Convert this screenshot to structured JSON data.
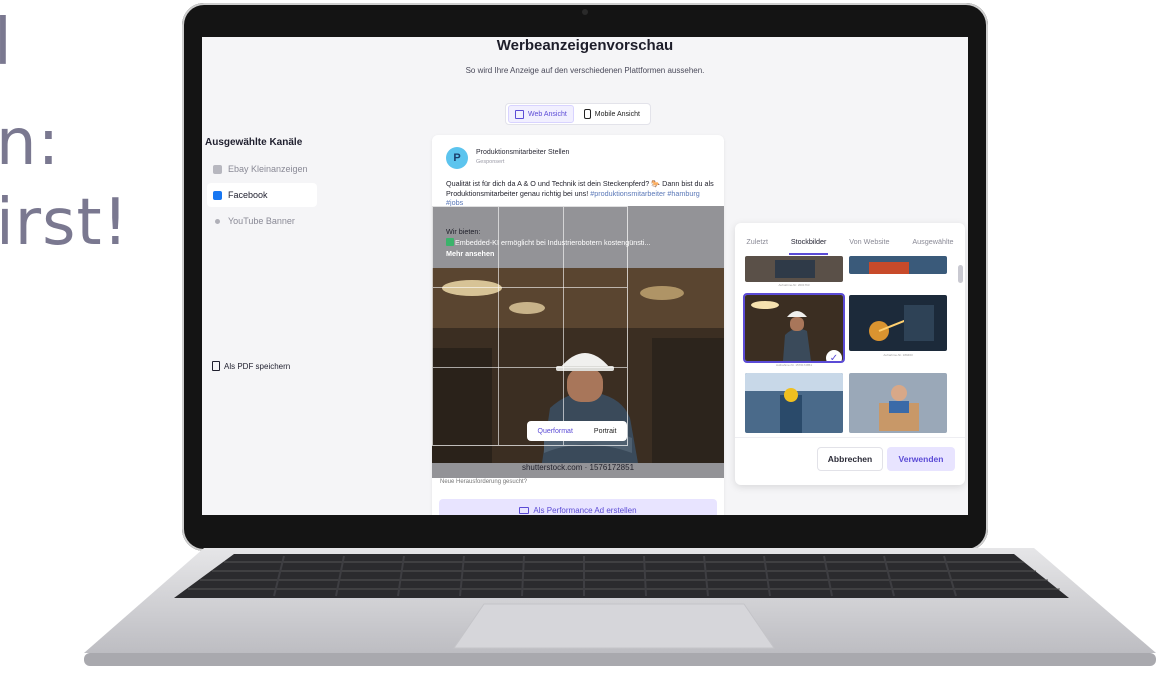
{
  "background_text": {
    "line1": "l",
    "line2": "n:",
    "line3": "irst!"
  },
  "page": {
    "title": "Werbeanzeigenvorschau",
    "subtitle": "So wird Ihre Anzeige auf den verschiedenen Plattformen aussehen."
  },
  "view_toggle": {
    "web_label": "Web Ansicht",
    "mobile_label": "Mobile Ansicht",
    "active": "web"
  },
  "sidebar": {
    "heading": "Ausgewählte Kanäle",
    "items": [
      {
        "label": "Ebay Kleinanzeigen",
        "icon": "ebay-icon",
        "active": false
      },
      {
        "label": "Facebook",
        "icon": "facebook-icon",
        "active": true
      },
      {
        "label": "YouTube Banner",
        "icon": "youtube-icon",
        "active": false
      }
    ],
    "pdf_label": "Als PDF speichern"
  },
  "ad": {
    "avatar_letter": "P",
    "page_name": "Produktionsmitarbeiter Stellen",
    "sponsored": "Gesponsert",
    "text_part1": "Qualität ist für dich da A & O und Technik ist dein Steckenpferd? 🐎 Dann bist du als Produktionsmitarbeiter genau richtig bei uns! ",
    "hashtags": "#produktionsmitarbeiter #hamburg #jobs",
    "offer_heading": "Wir bieten:",
    "offer_line": "Embedded-KI ermöglicht bei Industrierobotern kostengünsti...",
    "more_label": "Mehr ansehen",
    "image_credit": "shutterstock.com · 1576172851",
    "under_text": "Neue Herausforderung gesucht?",
    "performance_button": "Als Performance Ad erstellen"
  },
  "format_toggle": {
    "landscape": "Querformat",
    "portrait": "Portrait",
    "active": "landscape"
  },
  "stock_panel": {
    "tabs": [
      "Zuletzt",
      "Stockbilder",
      "Von Website",
      "Ausgewählte"
    ],
    "active_tab": "Stockbilder",
    "thumb_captions": [
      "Aufnahme-Nr. 2001763",
      "Aufnahme-Nr. 1576172851",
      "Aufnahme-Nr. 189463"
    ],
    "cancel_label": "Abbrechen",
    "use_label": "Verwenden"
  },
  "colors": {
    "accent": "#5b4bd6",
    "accent_light": "#e8e4ff",
    "facebook": "#1877f2",
    "avatar": "#5cc4ee"
  }
}
